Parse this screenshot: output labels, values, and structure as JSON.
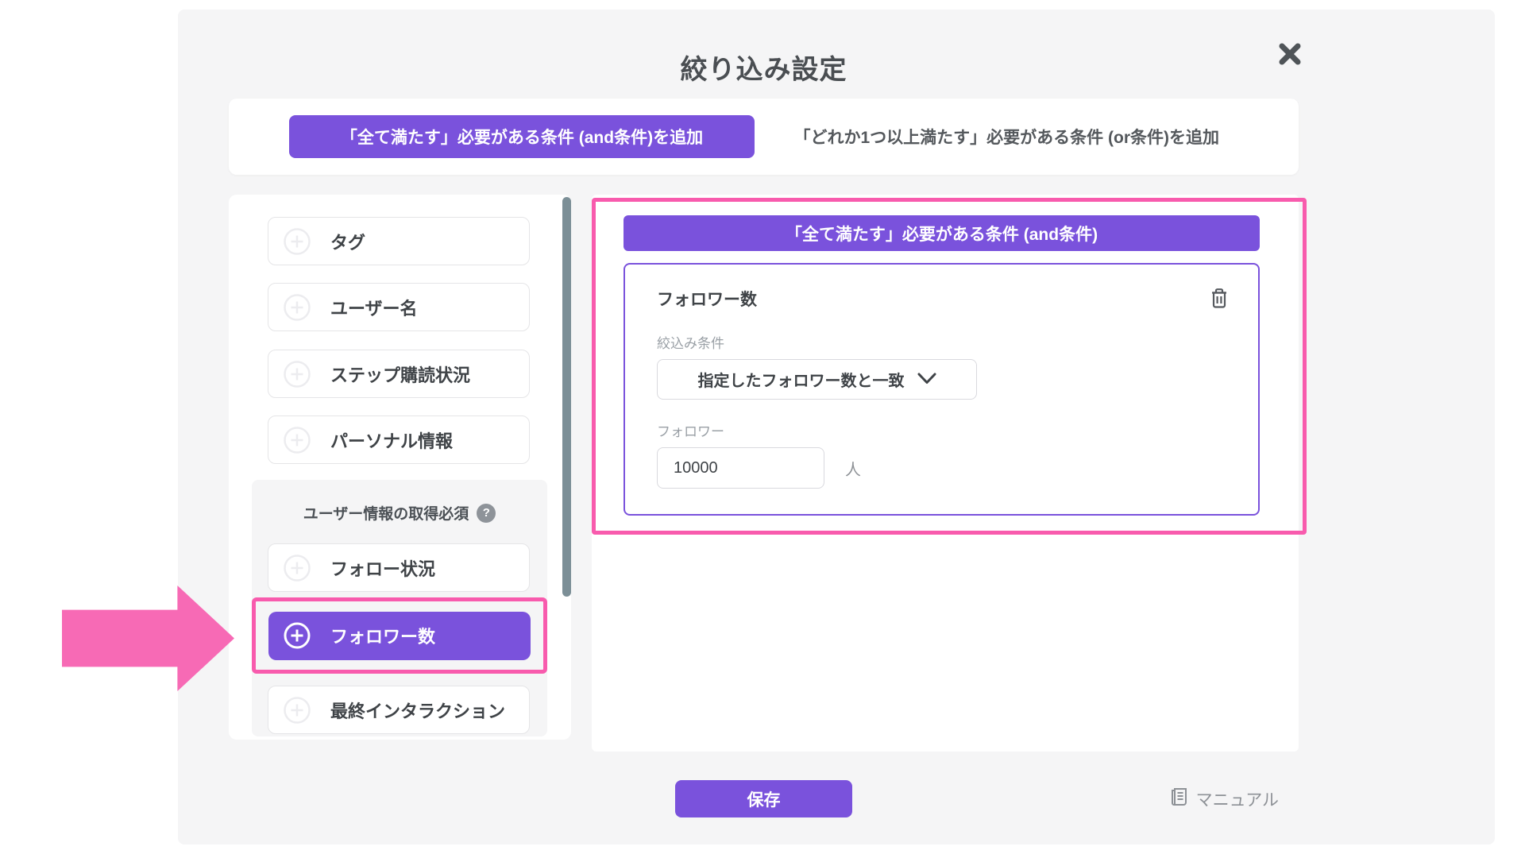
{
  "colors": {
    "accent": "#7a52dc",
    "pink": "#f85bad"
  },
  "modal": {
    "title": "絞り込み設定"
  },
  "top_bar": {
    "and_add_label": "「全て満たす」必要がある条件 (and条件)を追加",
    "or_add_label": "「どれか1つ以上満たす」必要がある条件 (or条件)を追加"
  },
  "sidebar": {
    "items": [
      {
        "label": "タグ"
      },
      {
        "label": "ユーザー名"
      },
      {
        "label": "ステップ購読状況"
      },
      {
        "label": "パーソナル情報"
      }
    ],
    "required_section": {
      "header": "ユーザー情報の取得必須",
      "help_glyph": "?",
      "items": [
        {
          "label": "フォロー状況"
        },
        {
          "label": "フォロワー数"
        },
        {
          "label": "最終インタラクション"
        }
      ]
    }
  },
  "condition_panel": {
    "group_header": "「全て満たす」必要がある条件 (and条件)",
    "condition": {
      "title": "フォロワー数",
      "filter_label": "絞込み条件",
      "filter_value": "指定したフォロワー数と一致",
      "count_label": "フォロワー",
      "count_value": "10000",
      "count_unit": "人"
    }
  },
  "footer": {
    "save_label": "保存",
    "manual_label": "マニュアル"
  }
}
